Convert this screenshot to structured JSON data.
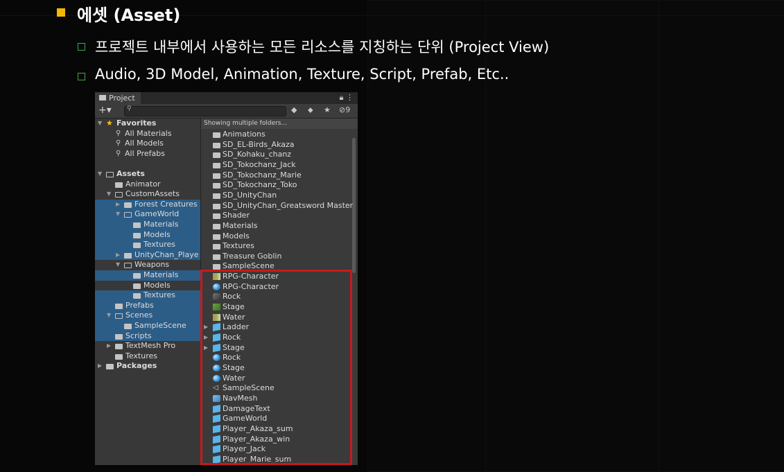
{
  "slide": {
    "title": "에셋 (Asset)",
    "bullets": [
      "프로젝트 내부에서 사용하는 모든 리소스를 지칭하는 단위 (Project View)",
      "Audio, 3D Model, Animation, Texture, Script, Prefab, Etc.."
    ],
    "accent_color": "#f5b800",
    "sub_bullet_color": "#3fa94a",
    "highlight_color": "#c8191d"
  },
  "project_window": {
    "tab_label": "Project",
    "search_placeholder": "",
    "hidden_count": "9",
    "list_header": "Showing multiple folders...",
    "tree": [
      {
        "label": "Favorites",
        "kind": "section",
        "icon": "star-icon"
      },
      {
        "label": "All Materials",
        "kind": "search"
      },
      {
        "label": "All Models",
        "kind": "search"
      },
      {
        "label": "All Prefabs",
        "kind": "search"
      },
      {
        "label": "Assets",
        "kind": "section",
        "icon": "folder-icon"
      },
      {
        "label": "Animator"
      },
      {
        "label": "CustomAssets"
      },
      {
        "label": "Forest Creatures I",
        "selected": true
      },
      {
        "label": "GameWorld",
        "selected": true
      },
      {
        "label": "Materials",
        "selected": true
      },
      {
        "label": "Models",
        "selected": true
      },
      {
        "label": "Textures",
        "selected": true
      },
      {
        "label": "UnityChan_Playe",
        "selected": true
      },
      {
        "label": "Weapons"
      },
      {
        "label": "Materials",
        "selected": true
      },
      {
        "label": "Models"
      },
      {
        "label": "Textures",
        "selected": true
      },
      {
        "label": "Prefabs",
        "selected": true
      },
      {
        "label": "Scenes",
        "selected": true
      },
      {
        "label": "SampleScene",
        "selected": true
      },
      {
        "label": "Scripts",
        "selected": true
      },
      {
        "label": "TextMesh Pro"
      },
      {
        "label": "Textures"
      },
      {
        "label": "Packages",
        "kind": "section"
      }
    ],
    "items": [
      {
        "label": "Animations",
        "icon": "folder"
      },
      {
        "label": "SD_EL-Birds_Akaza",
        "icon": "folder"
      },
      {
        "label": "SD_Kohaku_chanz",
        "icon": "folder"
      },
      {
        "label": "SD_Tokochanz_Jack",
        "icon": "folder"
      },
      {
        "label": "SD_Tokochanz_Marie",
        "icon": "folder"
      },
      {
        "label": "SD_Tokochanz_Toko",
        "icon": "folder"
      },
      {
        "label": "SD_UnityChan",
        "icon": "folder"
      },
      {
        "label": "SD_UnityChan_Greatsword Master",
        "icon": "folder"
      },
      {
        "label": "Shader",
        "icon": "folder"
      },
      {
        "label": "Materials",
        "icon": "folder"
      },
      {
        "label": "Models",
        "icon": "folder"
      },
      {
        "label": "Textures",
        "icon": "folder"
      },
      {
        "label": "Treasure Goblin",
        "icon": "folder"
      },
      {
        "label": "SampleScene",
        "icon": "folder"
      },
      {
        "label": "RPG-Character",
        "icon": "tex"
      },
      {
        "label": "RPG-Character",
        "icon": "mat"
      },
      {
        "label": "Rock",
        "icon": "rock"
      },
      {
        "label": "Stage",
        "icon": "grass"
      },
      {
        "label": "Water",
        "icon": "tex"
      },
      {
        "label": "Ladder",
        "icon": "cube",
        "expandable": true
      },
      {
        "label": "Rock",
        "icon": "cube",
        "expandable": true
      },
      {
        "label": "Stage",
        "icon": "cube",
        "expandable": true
      },
      {
        "label": "Rock",
        "icon": "mat"
      },
      {
        "label": "Stage",
        "icon": "mat"
      },
      {
        "label": "Water",
        "icon": "mat"
      },
      {
        "label": "SampleScene",
        "icon": "scene"
      },
      {
        "label": "NavMesh",
        "icon": "nav"
      },
      {
        "label": "DamageText",
        "icon": "cube"
      },
      {
        "label": "GameWorld",
        "icon": "cube"
      },
      {
        "label": "Player_Akaza_sum",
        "icon": "cube"
      },
      {
        "label": "Player_Akaza_win",
        "icon": "cube"
      },
      {
        "label": "Player_Jack",
        "icon": "cube"
      },
      {
        "label": "Player_Marie_sum",
        "icon": "cube"
      }
    ]
  }
}
